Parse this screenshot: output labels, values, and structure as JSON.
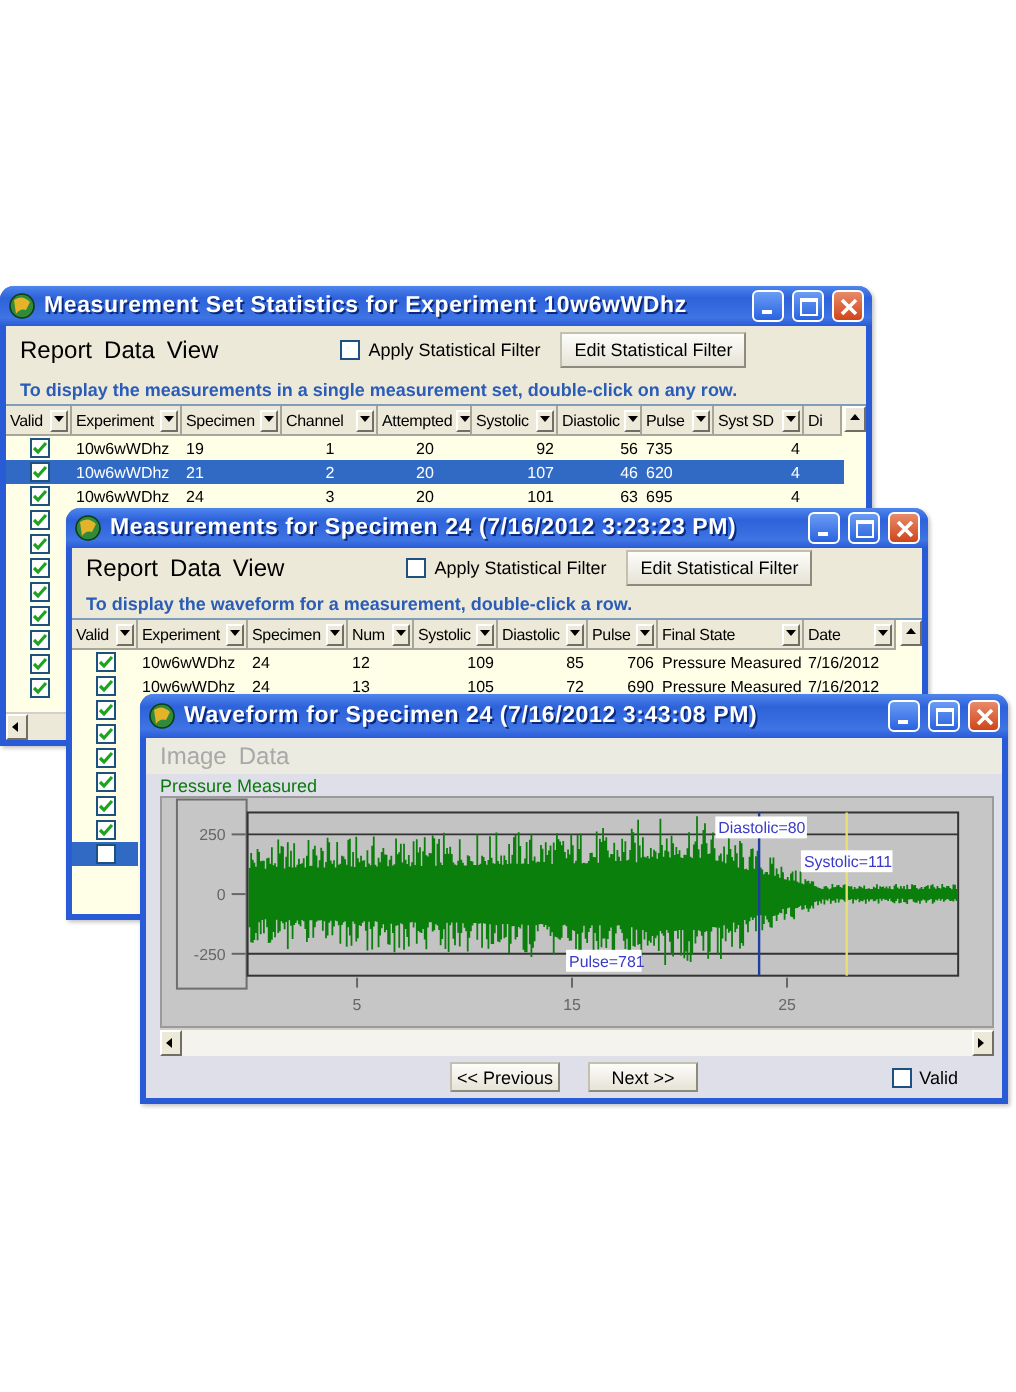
{
  "windows": [
    {
      "kind": "grid",
      "title": "Measurement Set Statistics for Experiment 10w6wWDhz",
      "menu": [
        {
          "label": "Report",
          "disabled": false
        },
        {
          "label": "Data",
          "disabled": false
        },
        {
          "label": "View",
          "disabled": false
        }
      ],
      "filter": {
        "label": "Apply Statistical Filter",
        "checked": false
      },
      "edit_button": "Edit Statistical Filter",
      "hint": "To display the measurements in a single measurement set, double-click on any row.",
      "columns": [
        {
          "label": "Valid",
          "dropdown": true
        },
        {
          "label": "Experiment",
          "dropdown": true
        },
        {
          "label": "Specimen",
          "dropdown": true
        },
        {
          "label": "Channel",
          "dropdown": true
        },
        {
          "label": "Attempted",
          "dropdown": true
        },
        {
          "label": "Systolic",
          "dropdown": true
        },
        {
          "label": "Diastolic",
          "dropdown": true
        },
        {
          "label": "Pulse",
          "dropdown": true
        },
        {
          "label": "Syst SD",
          "dropdown": true
        },
        {
          "label": "Di",
          "dropdown": false
        }
      ],
      "rows": [
        {
          "valid": true,
          "selected": false,
          "cells": [
            "10w6wWDhz",
            "19",
            "1",
            "20",
            "92",
            "56",
            "735",
            "4"
          ]
        },
        {
          "valid": true,
          "selected": true,
          "cells": [
            "10w6wWDhz",
            "21",
            "2",
            "20",
            "107",
            "46",
            "620",
            "4"
          ]
        },
        {
          "valid": true,
          "selected": false,
          "cells": [
            "10w6wWDhz",
            "24",
            "3",
            "20",
            "101",
            "63",
            "695",
            "4"
          ]
        },
        {
          "valid": true,
          "selected": false
        },
        {
          "valid": true,
          "selected": false
        },
        {
          "valid": true,
          "selected": false
        },
        {
          "valid": true,
          "selected": false
        },
        {
          "valid": true,
          "selected": false
        },
        {
          "valid": true,
          "selected": false
        },
        {
          "valid": true,
          "selected": false
        },
        {
          "valid": true,
          "selected": false
        }
      ]
    },
    {
      "kind": "grid",
      "title": "Measurements for Specimen 24 (7/16/2012 3:23:23 PM)",
      "menu": [
        {
          "label": "Report",
          "disabled": false
        },
        {
          "label": "Data",
          "disabled": false
        },
        {
          "label": "View",
          "disabled": false
        }
      ],
      "filter": {
        "label": "Apply Statistical Filter",
        "checked": false
      },
      "edit_button": "Edit Statistical Filter",
      "hint": "To display the waveform for a measurement, double-click a row.",
      "columns": [
        {
          "label": "Valid",
          "dropdown": true
        },
        {
          "label": "Experiment",
          "dropdown": true
        },
        {
          "label": "Specimen",
          "dropdown": true
        },
        {
          "label": "Num",
          "dropdown": true
        },
        {
          "label": "Systolic",
          "dropdown": true
        },
        {
          "label": "Diastolic",
          "dropdown": true
        },
        {
          "label": "Pulse",
          "dropdown": true
        },
        {
          "label": "Final State",
          "dropdown": true
        },
        {
          "label": "Date",
          "dropdown": true
        }
      ],
      "rows": [
        {
          "valid": true,
          "selected": false,
          "cells": [
            "10w6wWDhz",
            "24",
            "12",
            "109",
            "85",
            "706",
            "Pressure Measured",
            "7/16/2012"
          ]
        },
        {
          "valid": true,
          "selected": false,
          "cells": [
            "10w6wWDhz",
            "24",
            "13",
            "105",
            "72",
            "690",
            "Pressure Measured",
            "7/16/2012"
          ]
        },
        {
          "valid": true,
          "selected": false
        },
        {
          "valid": true,
          "selected": false
        },
        {
          "valid": true,
          "selected": false
        },
        {
          "valid": true,
          "selected": false
        },
        {
          "valid": true,
          "selected": false
        },
        {
          "valid": true,
          "selected": false
        },
        {
          "valid": false,
          "selected": true
        }
      ]
    },
    {
      "kind": "waveform",
      "title": "Waveform for Specimen 24 (7/16/2012 3:43:08 PM)",
      "menu": [
        {
          "label": "Image",
          "disabled": true
        },
        {
          "label": "Data",
          "disabled": true
        }
      ],
      "state_label": "Pressure Measured",
      "y_ticks": [
        "250",
        "0",
        "-250"
      ],
      "x_ticks": [
        "5",
        "15",
        "25"
      ],
      "markers": [
        {
          "kind": "diastolic",
          "label": "Diastolic=80"
        },
        {
          "kind": "systolic",
          "label": "Systolic=111"
        },
        {
          "kind": "pulse",
          "label": "Pulse=781"
        }
      ],
      "nav_buttons": [
        "<< Previous",
        "Next >>"
      ],
      "valid": {
        "label": "Valid",
        "checked": false
      }
    }
  ]
}
